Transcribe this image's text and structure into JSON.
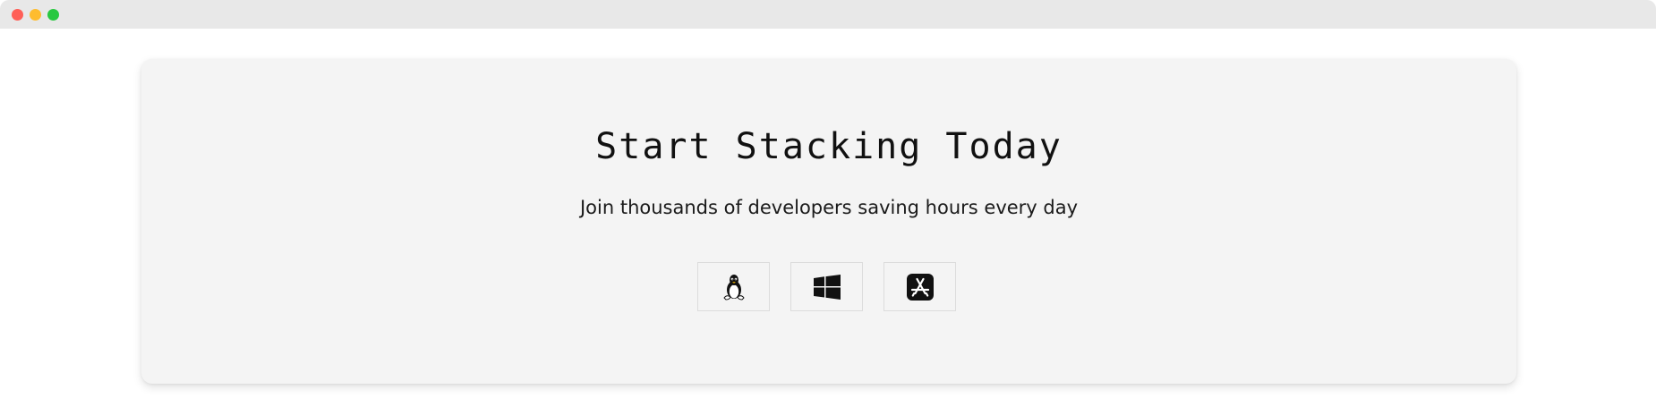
{
  "window": {
    "controls": [
      "close",
      "minimize",
      "zoom"
    ]
  },
  "hero": {
    "title": "Start Stacking Today",
    "subtitle": "Join thousands of developers saving hours every day"
  },
  "downloads": [
    {
      "platform": "Linux",
      "icon": "linux-tux-icon"
    },
    {
      "platform": "Windows",
      "icon": "windows-logo-icon"
    },
    {
      "platform": "App Store",
      "icon": "app-store-icon"
    }
  ],
  "colors": {
    "titlebar": "#e8e8e8",
    "close": "#ff5f57",
    "minimize": "#febc2e",
    "zoom": "#28c840",
    "card": "#f4f4f4",
    "text": "#111111"
  }
}
